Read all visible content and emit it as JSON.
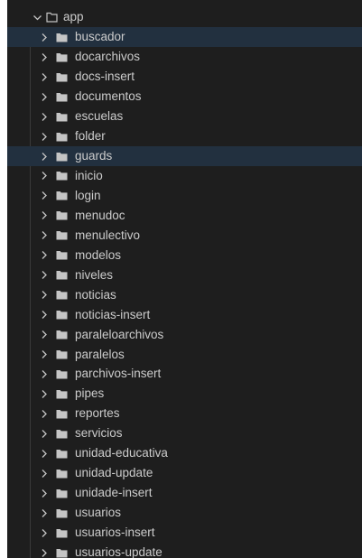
{
  "explorer": {
    "root": {
      "label": "app",
      "expanded": true,
      "chevron_icon": "chevron-down-icon",
      "folder_icon": "folder-open-outline-icon"
    },
    "children": [
      {
        "label": "buscador",
        "highlighted": true
      },
      {
        "label": "docarchivos"
      },
      {
        "label": "docs-insert"
      },
      {
        "label": "documentos"
      },
      {
        "label": "escuelas"
      },
      {
        "label": "folder"
      },
      {
        "label": "guards",
        "highlighted": true
      },
      {
        "label": "inicio"
      },
      {
        "label": "login"
      },
      {
        "label": "menudoc"
      },
      {
        "label": "menulectivo"
      },
      {
        "label": "modelos"
      },
      {
        "label": "niveles"
      },
      {
        "label": "noticias"
      },
      {
        "label": "noticias-insert"
      },
      {
        "label": "paraleloarchivos"
      },
      {
        "label": "paralelos"
      },
      {
        "label": "parchivos-insert"
      },
      {
        "label": "pipes"
      },
      {
        "label": "reportes"
      },
      {
        "label": "servicios"
      },
      {
        "label": "unidad-educativa"
      },
      {
        "label": "unidad-update"
      },
      {
        "label": "unidade-insert"
      },
      {
        "label": "usuarios"
      },
      {
        "label": "usuarios-insert"
      },
      {
        "label": "usuarios-update"
      }
    ]
  },
  "colors": {
    "background": "#1e1e1e",
    "text": "#cccccc",
    "highlight": "#22303f",
    "icon": "#c5c5c5"
  }
}
